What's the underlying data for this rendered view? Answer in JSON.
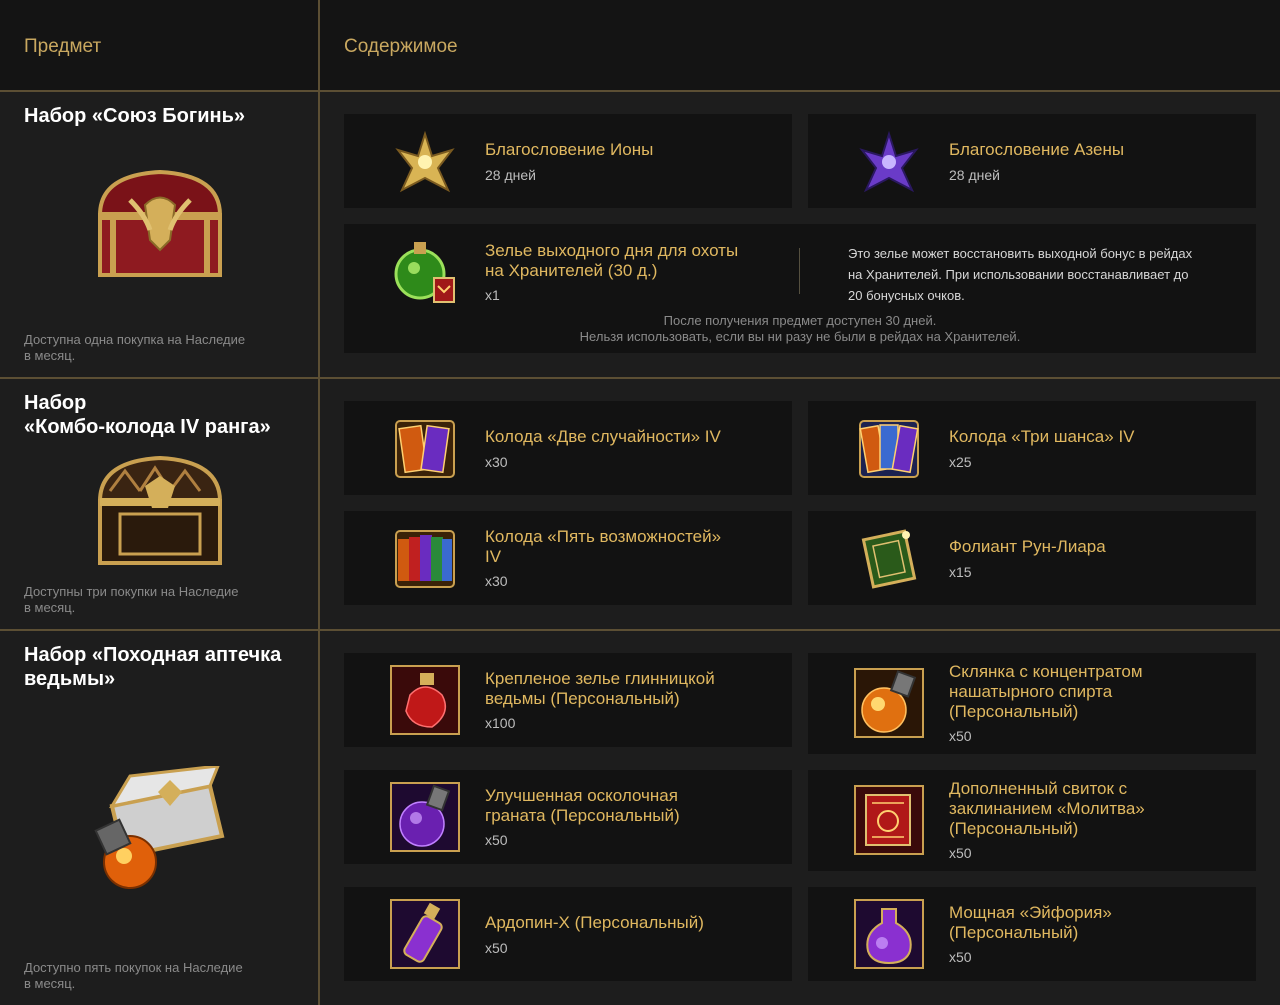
{
  "header": {
    "col1": "Предмет",
    "col2": "Содержимое"
  },
  "sets": [
    {
      "title_l1": "Набор «Союз Богинь»",
      "title_l2": "",
      "note_l1": "Доступна одна покупка на Наследие",
      "note_l2": "в месяц.",
      "items": [
        {
          "name_l1": "Благословение Ионы",
          "sub": "28 дней"
        },
        {
          "name_l1": "Благословение Азены",
          "sub": "28 дней"
        },
        {
          "name_l1": "Зелье выходного дня для охоты",
          "name_l2": "на Хранителей (30 д.)",
          "sub": "x1",
          "desc_l1": "Это зелье может восстановить выходной бонус в рейдах",
          "desc_l2": "на Хранителей. При использовании восстанавливает до",
          "desc_l3": "20 бонусных очков.",
          "note_l1": "После получения предмет доступен 30 дней.",
          "note_l2": "Нельзя использовать, если вы ни разу не были в рейдах на Хранителей."
        }
      ]
    },
    {
      "title_l1": "Набор",
      "title_l2": "«Комбо-колода IV ранга»",
      "note_l1": "Доступны три покупки на Наследие",
      "note_l2": "в месяц.",
      "items": [
        {
          "name_l1": "Колода «Две случайности» IV",
          "sub": "x30"
        },
        {
          "name_l1": "Колода «Три шанса» IV",
          "sub": "x25"
        },
        {
          "name_l1": "Колода «Пять возможностей»",
          "name_l2": "IV",
          "sub": "x30"
        },
        {
          "name_l1": "Фолиант Рун-Лиара",
          "sub": "x15"
        }
      ]
    },
    {
      "title_l1": "Набор «Походная аптечка",
      "title_l2": "ведьмы»",
      "note_l1": "Доступно пять покупок на Наследие",
      "note_l2": "в месяц.",
      "items": [
        {
          "name_l1": "Крепленое зелье глинницкой",
          "name_l2": "ведьмы (Персональный)",
          "sub": "x100"
        },
        {
          "name_l1": "Склянка с концентратом",
          "name_l2": "нашатырного спирта",
          "name_l3": "(Персональный)",
          "sub": "x50"
        },
        {
          "name_l1": "Улучшенная осколочная",
          "name_l2": "граната (Персональный)",
          "sub": "x50"
        },
        {
          "name_l1": "Дополненный свиток с",
          "name_l2": "заклинанием «Молитва»",
          "name_l3": "(Персональный)",
          "sub": "x50"
        },
        {
          "name_l1": "Ардопин-X (Персональный)",
          "sub": "x50"
        },
        {
          "name_l1": "Мощная «Эйфория»",
          "name_l2": "(Персональный)",
          "sub": "x50"
        }
      ]
    }
  ],
  "colors": {
    "accent_gold": "#e0b860",
    "divider": "#5c4f34",
    "panel": "#1d1d1d",
    "card": "#121212"
  }
}
